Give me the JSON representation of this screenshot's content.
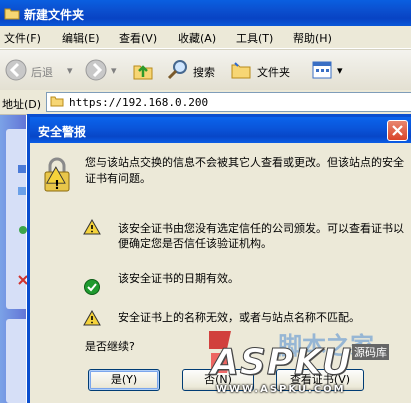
{
  "window": {
    "title": "新建文件夹"
  },
  "menu": {
    "items": [
      "文件(F)",
      "编辑(E)",
      "查看(V)",
      "收藏(A)",
      "工具(T)",
      "帮助(H)"
    ]
  },
  "toolbar": {
    "back_label": "后退",
    "search_label": "搜索",
    "folders_label": "文件夹"
  },
  "address": {
    "label": "地址(D)",
    "value": "https://192.168.0.200"
  },
  "dialog": {
    "title": "安全警报",
    "message": "您与该站点交换的信息不会被其它人查看或更改。但该站点的安全证书有问题。",
    "items": [
      {
        "status": "warning",
        "text": "该安全证书由您没有选定信任的公司颁发。可以查看证书以便确定您是否信任该验证机构。"
      },
      {
        "status": "ok",
        "text": "该安全证书的日期有效。"
      },
      {
        "status": "warning",
        "text": "安全证书上的名称无效，或者与站点名称不匹配。"
      }
    ],
    "question": "是否继续?",
    "buttons": {
      "yes": "是(Y)",
      "no": "否(N)",
      "view": "查看证书(V)"
    }
  },
  "watermark": {
    "logo_text": "ASPKU",
    "sub_text": "WWW.ASPKU.COM",
    "tag": "源码库",
    "cn": "脚本之家"
  },
  "colors": {
    "xp_blue": "#0a54d9",
    "close_red": "#d9442a",
    "warning_yellow": "#f5d33b",
    "ok_green": "#1f9a2f"
  }
}
